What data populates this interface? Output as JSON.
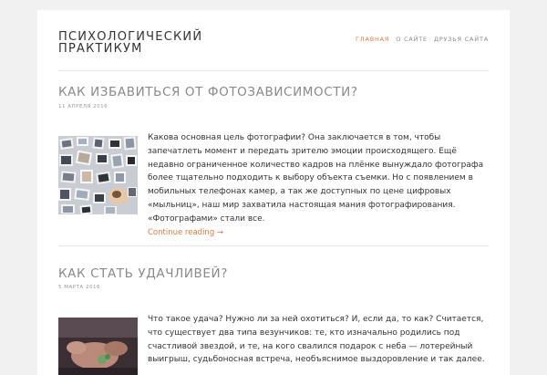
{
  "site": {
    "title": "Психологический практикум"
  },
  "nav": {
    "items": [
      "Главная",
      "О сайте",
      "Друзья сайта"
    ],
    "active_color": "#e0793d"
  },
  "posts": [
    {
      "title": "Как избавиться от фотозависимости?",
      "date": "11 апреля 2016",
      "excerpt": "Какова основная цель фотографии? Она заключается в том, чтобы запечатлеть момент и передать зрителю эмоции происходящего. Ещё недавно ограниченное количество кадров на плёнке вынуждало фотографа более тщательно подходить к выбору объекта съемки. Но с появлением в мобильных телефонах камер, а так же доступных по цене цифровых «мыльниц», наш мир захватила настоящая мания фотографирования. «Фотографами» стали все.",
      "more": "Continue reading →"
    },
    {
      "title": "Как стать удачливей?",
      "date": "5 марта 2016",
      "excerpt": "Что такое удача? Нужно ли за ней охотиться? И, если да, то как? Считается, что существует два типа везунчиков: те, кто изначально родились под счастливой звездой, и те, на кого свалился подарок с неба — лотерейный выигрыш, судьбоносная встреча, необъяснимое выздоровление и так далее."
    }
  ]
}
